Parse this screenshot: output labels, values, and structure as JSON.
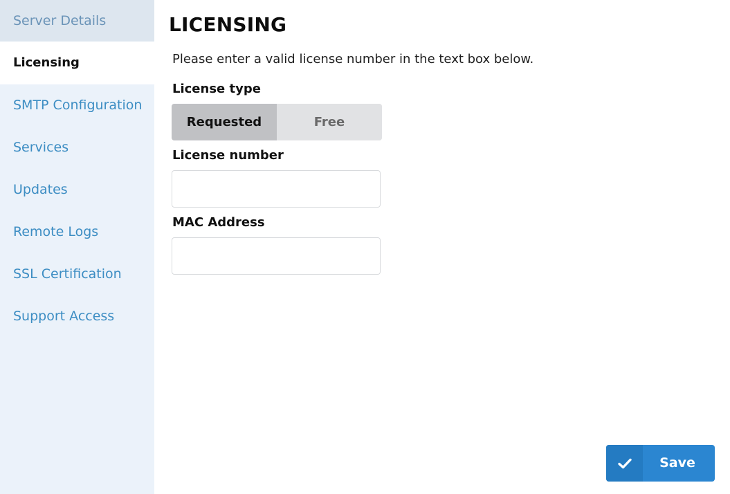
{
  "sidebar": {
    "items": [
      {
        "label": "Server Details"
      },
      {
        "label": "Licensing"
      },
      {
        "label": "SMTP Configuration"
      },
      {
        "label": "Services"
      },
      {
        "label": "Updates"
      },
      {
        "label": "Remote Logs"
      },
      {
        "label": "SSL Certification"
      },
      {
        "label": "Support Access"
      }
    ],
    "active": "Licensing"
  },
  "main": {
    "title": "LICENSING",
    "intro": "Please enter a valid license number in the text box below.",
    "license_type": {
      "label": "License type",
      "options": [
        "Requested",
        "Free"
      ],
      "selected": "Requested"
    },
    "license_number": {
      "label": "License number",
      "value": "",
      "placeholder": ""
    },
    "mac_address": {
      "label": "MAC Address",
      "value": "",
      "placeholder": ""
    }
  },
  "actions": {
    "save_label": "Save",
    "save_icon": "checkmark-icon"
  },
  "colors": {
    "sidebar_bg": "#ebf2fa",
    "nav_link": "#3c8dc3",
    "accent": "#2b86d1",
    "toggle_selected": "#c0c1c4",
    "toggle_unselected": "#e1e2e4"
  }
}
